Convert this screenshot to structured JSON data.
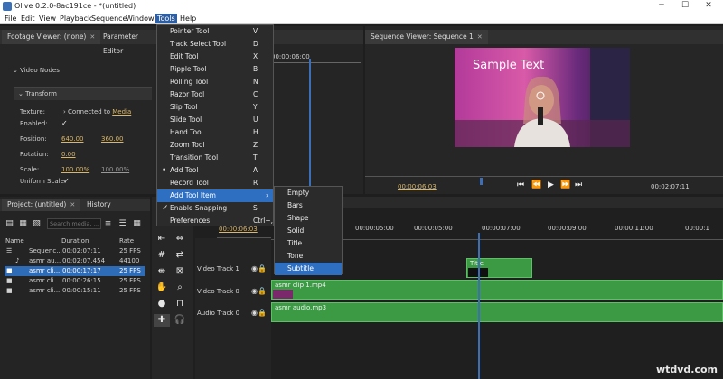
{
  "window": {
    "title": "Olive 0.2.0-8ac191ce - *(untitled)"
  },
  "menubar": [
    "File",
    "Edit",
    "View",
    "Playback",
    "Sequence",
    "Window",
    "Tools",
    "Help"
  ],
  "tools_menu": {
    "items": [
      {
        "label": "Pointer Tool",
        "shortcut": "V"
      },
      {
        "label": "Track Select Tool",
        "shortcut": "D"
      },
      {
        "label": "Edit Tool",
        "shortcut": "X"
      },
      {
        "label": "Ripple Tool",
        "shortcut": "B"
      },
      {
        "label": "Rolling Tool",
        "shortcut": "N"
      },
      {
        "label": "Razor Tool",
        "shortcut": "C"
      },
      {
        "label": "Slip Tool",
        "shortcut": "Y"
      },
      {
        "label": "Slide Tool",
        "shortcut": "U"
      },
      {
        "label": "Hand Tool",
        "shortcut": "H"
      },
      {
        "label": "Zoom Tool",
        "shortcut": "Z"
      },
      {
        "label": "Transition Tool",
        "shortcut": "T"
      },
      {
        "label": "Add Tool",
        "shortcut": "A"
      },
      {
        "label": "Record Tool",
        "shortcut": "R"
      },
      {
        "label": "Add Tool Item",
        "shortcut": ""
      },
      {
        "label": "Enable Snapping",
        "shortcut": "S"
      },
      {
        "label": "Preferences",
        "shortcut": "Ctrl+,"
      }
    ]
  },
  "submenu": [
    "Empty",
    "Bars",
    "Shape",
    "Solid",
    "Title",
    "Tone",
    "Subtitle"
  ],
  "footage": {
    "tab": "Footage Viewer: (none)",
    "param_tab": "Parameter Editor"
  },
  "params": {
    "video_nodes": "Video Nodes",
    "transform": "Transform",
    "texture_label": "Texture:",
    "texture_value": "Connected to",
    "texture_link": "Media",
    "enabled_label": "Enabled:",
    "position_label": "Position:",
    "pos_x": "640.00",
    "pos_y": "360.00",
    "rotation_label": "Rotation:",
    "rotation": "0.00",
    "scale_label": "Scale:",
    "scale_x": "100.00%",
    "scale_y": "100.00%",
    "uniform_label": "Uniform Scale:"
  },
  "center_viewer": {
    "time": "00:00:06:00"
  },
  "sequence_viewer": {
    "tab": "Sequence Viewer: Sequence 1",
    "overlay_text": "Sample Text",
    "current_time": "00:00:06:03",
    "duration": "00:02:07:11"
  },
  "project": {
    "tab": "Project: (untitled)",
    "history_tab": "History",
    "search_placeholder": "Search media, ...",
    "columns": [
      "Name",
      "Duration",
      "Rate"
    ],
    "rows": [
      {
        "name": "Sequenc...",
        "duration": "00:02:07:11",
        "rate": "25 FPS"
      },
      {
        "name": "asmr au...",
        "duration": "00:02:07.454",
        "rate": "44100 H"
      },
      {
        "name": "asmr cli...",
        "duration": "00:00:17:17",
        "rate": "25 FPS"
      },
      {
        "name": "asmr cli...",
        "duration": "00:00:26:15",
        "rate": "25 FPS"
      },
      {
        "name": "asmr cli...",
        "duration": "00:00:15:11",
        "rate": "25 FPS"
      }
    ]
  },
  "timeline": {
    "timecode": "00:00:06:03",
    "ruler": [
      "00:00:03:00",
      "00:00:05:00",
      "00:00:07:00",
      "00:00:09:00",
      "00:00:11:00",
      "00:00:1"
    ],
    "tracks": [
      "Video Track 1",
      "Video Track 0",
      "Audio Track 0"
    ],
    "clips": {
      "title": "Title",
      "video": "asmr clip 1.mp4",
      "audio": "asmr audio.mp3"
    }
  },
  "watermark": "wtdvd.com",
  "colors": {
    "menu_highlight": "#2e6fc2",
    "clip_green": "#3c9a45",
    "selected_row": "#2f6cb8"
  }
}
